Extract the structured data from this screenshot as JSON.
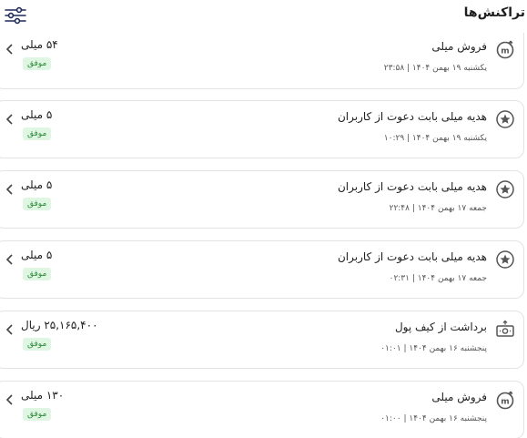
{
  "header": {
    "title": "تراکنش‌ها",
    "filter_icon": "sliders-icon"
  },
  "transactions": [
    {
      "title": "فروش میلی",
      "date": "یکشنبه ۱۹ بهمن ۱۴۰۴ | ۲۳:۵۸",
      "amount": "۵۴ میلی",
      "status": "موفق",
      "icon": "m-coin-icon"
    },
    {
      "title": "هدیه میلی بابت دعوت از کاربران",
      "date": "یکشنبه ۱۹ بهمن ۱۴۰۴ | ۱۰:۲۹",
      "amount": "۵ میلی",
      "status": "موفق",
      "icon": "star-icon"
    },
    {
      "title": "هدیه میلی بابت دعوت از کاربران",
      "date": "جمعه ۱۷ بهمن ۱۴۰۴ | ۲۲:۴۸",
      "amount": "۵ میلی",
      "status": "موفق",
      "icon": "star-icon"
    },
    {
      "title": "هدیه میلی بابت دعوت از کاربران",
      "date": "جمعه ۱۷ بهمن ۱۴۰۴ | ۰۲:۳۱",
      "amount": "۵ میلی",
      "status": "موفق",
      "icon": "star-icon"
    },
    {
      "title": "برداشت از کیف پول",
      "date": "پنجشنبه ۱۶ بهمن ۱۴۰۴ | ۰۱:۰۱",
      "amount": "۲۵,۱۶۵,۴۰۰ ریال",
      "status": "موفق",
      "icon": "cash-withdraw-icon"
    },
    {
      "title": "فروش میلی",
      "date": "پنجشنبه ۱۶ بهمن ۱۴۰۴ | ۰۱:۰۰",
      "amount": "۱۳۰ میلی",
      "status": "موفق",
      "icon": "m-coin-icon"
    }
  ]
}
